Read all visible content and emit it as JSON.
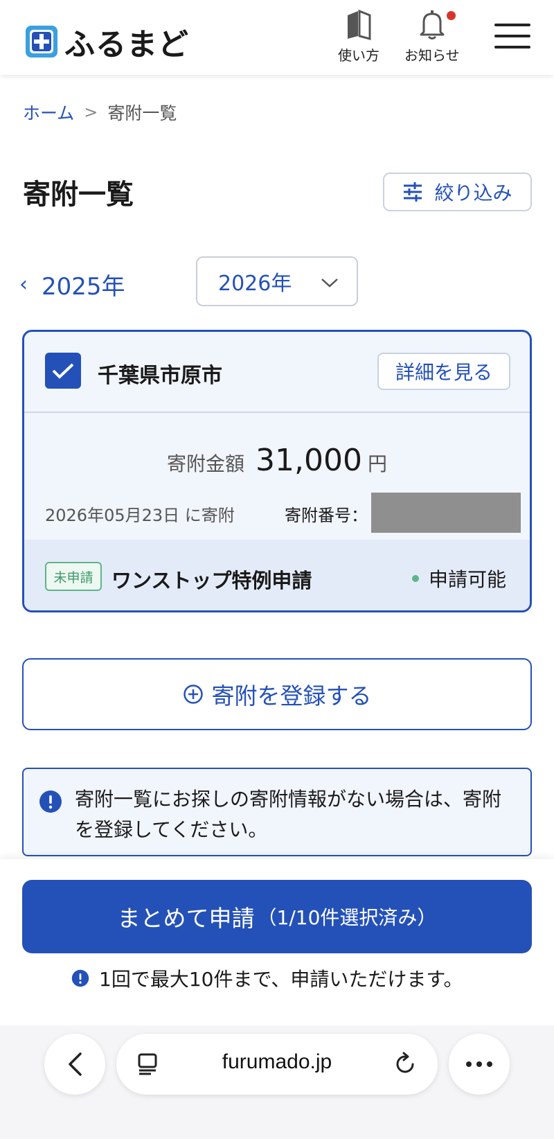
{
  "header": {
    "logo_text": "ふるまど",
    "guide_label": "使い方",
    "notice_label": "お知らせ",
    "accent_color": "#2451b8",
    "notice_dot_color": "#d9342b"
  },
  "breadcrumb": {
    "home": "ホーム",
    "separator": ">",
    "current": "寄附一覧"
  },
  "page": {
    "title": "寄附一覧",
    "filter_label": "絞り込み"
  },
  "year_nav": {
    "prev_year": "2025年",
    "selected_year": "2026年"
  },
  "donation_card": {
    "checked": true,
    "municipality": "千葉県市原市",
    "detail_button": "詳細を見る",
    "amount_label": "寄附金額",
    "amount_value": "31,000",
    "amount_unit": "円",
    "date_text": "2026年05月23日 に寄附",
    "number_label": "寄附番号：",
    "badge": "未申請",
    "application_title": "ワンストップ特例申請",
    "status": "申請可能",
    "status_color": "#5bb58a"
  },
  "register_button": "寄附を登録する",
  "info_message": "寄附一覧にお探しの寄附情報がない場合は、寄附を登録してください。",
  "bulk_apply": {
    "label": "まとめて申請",
    "count_text": "（1/10件選択済み）"
  },
  "limit_note": "1回で最大10件まで、申請いただけます。",
  "browser": {
    "url": "furumado.jp"
  }
}
